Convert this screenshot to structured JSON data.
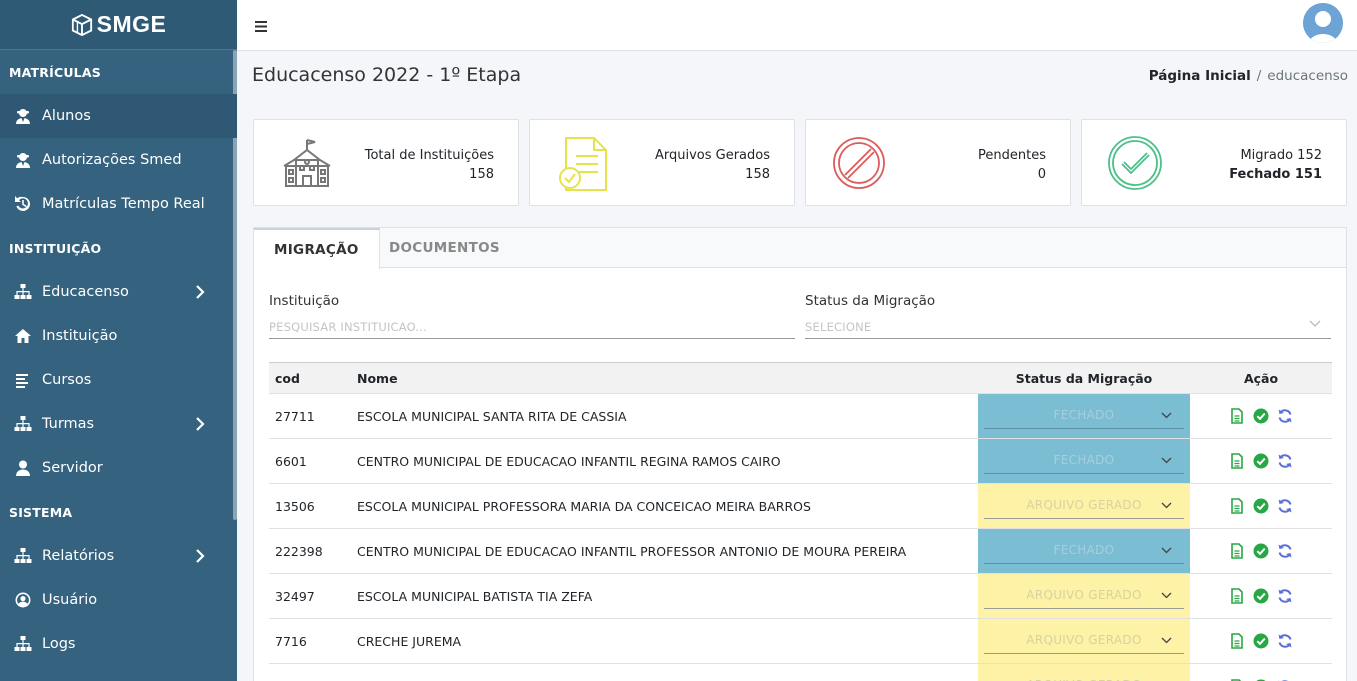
{
  "brand": {
    "name": "SMGE"
  },
  "sidebar": {
    "sections": [
      {
        "header": "MATRÍCULAS",
        "items": [
          {
            "label": "Alunos",
            "icon": "user-tie-icon",
            "active": true
          },
          {
            "label": "Autorizações Smed",
            "icon": "user-tie-icon"
          },
          {
            "label": "Matrículas Tempo Real",
            "icon": "history-icon"
          }
        ]
      },
      {
        "header": "INSTITUIÇÃO",
        "items": [
          {
            "label": "Educacenso",
            "icon": "sitemap-icon",
            "chevron": true
          },
          {
            "label": "Instituição",
            "icon": "home-icon"
          },
          {
            "label": "Cursos",
            "icon": "align-left-icon"
          },
          {
            "label": "Turmas",
            "icon": "sitemap-icon",
            "chevron": true
          },
          {
            "label": "Servidor",
            "icon": "user-icon"
          }
        ]
      },
      {
        "header": "SISTEMA",
        "items": [
          {
            "label": "Relatórios",
            "icon": "sitemap-icon",
            "chevron": true
          },
          {
            "label": "Usuário",
            "icon": "user-circle-icon"
          },
          {
            "label": "Logs",
            "icon": "sitemap-icon"
          }
        ]
      }
    ]
  },
  "topbar": {
    "menu_icon": "hamburger-icon",
    "avatar_icon": "user-avatar-icon"
  },
  "page": {
    "title": "Educacenso 2022 - 1º Etapa",
    "breadcrumb": {
      "home": "Página Inicial",
      "current": "educacenso"
    }
  },
  "stats": [
    {
      "label": "Total de Instituições",
      "value": "158",
      "icon": "school-icon",
      "color": "#777777"
    },
    {
      "label": "Arquivos Gerados",
      "value": "158",
      "icon": "file-check-icon",
      "color": "#e6e34a"
    },
    {
      "label": "Pendentes",
      "value": "0",
      "icon": "ban-icon",
      "color": "#dc5b5b"
    },
    {
      "label": "Migrado 152",
      "value": "Fechado 151",
      "icon": "check-circle-icon",
      "color": "#4cc08a"
    }
  ],
  "tabs": [
    {
      "label": "MIGRAÇÃO",
      "active": true
    },
    {
      "label": "DOCUMENTOS"
    }
  ],
  "filters": {
    "instituicao": {
      "label": "Instituição",
      "placeholder": "PESQUISAR INSTITUICAO..."
    },
    "status": {
      "label": "Status da Migração",
      "placeholder": "SELECIONE"
    }
  },
  "table": {
    "headers": {
      "cod": "cod",
      "nome": "Nome",
      "status": "Status da Migração",
      "acao": "Ação"
    },
    "rows": [
      {
        "cod": "27711",
        "nome": "ESCOLA MUNICIPAL SANTA RITA DE CASSIA",
        "status": "FECHADO"
      },
      {
        "cod": "6601",
        "nome": "CENTRO MUNICIPAL DE EDUCACAO INFANTIL REGINA RAMOS CAIRO",
        "status": "FECHADO"
      },
      {
        "cod": "13506",
        "nome": "ESCOLA MUNICIPAL PROFESSORA MARIA DA CONCEICAO MEIRA BARROS",
        "status": "ARQUIVO GERADO"
      },
      {
        "cod": "222398",
        "nome": "CENTRO MUNICIPAL DE EDUCACAO INFANTIL PROFESSOR ANTONIO DE MOURA PEREIRA",
        "status": "FECHADO"
      },
      {
        "cod": "32497",
        "nome": "ESCOLA MUNICIPAL BATISTA TIA ZEFA",
        "status": "ARQUIVO GERADO"
      },
      {
        "cod": "7716",
        "nome": "CRECHE JUREMA",
        "status": "ARQUIVO GERADO"
      },
      {
        "cod": "",
        "nome": "",
        "status": "ARQUIVO GERADO",
        "partial": true
      }
    ],
    "action_icons": [
      "file-icon",
      "check-circle-icon",
      "sync-icon"
    ],
    "colors": {
      "fechado": "#7bbdd3",
      "arquivo_gerado": "#fdf2a6"
    }
  }
}
